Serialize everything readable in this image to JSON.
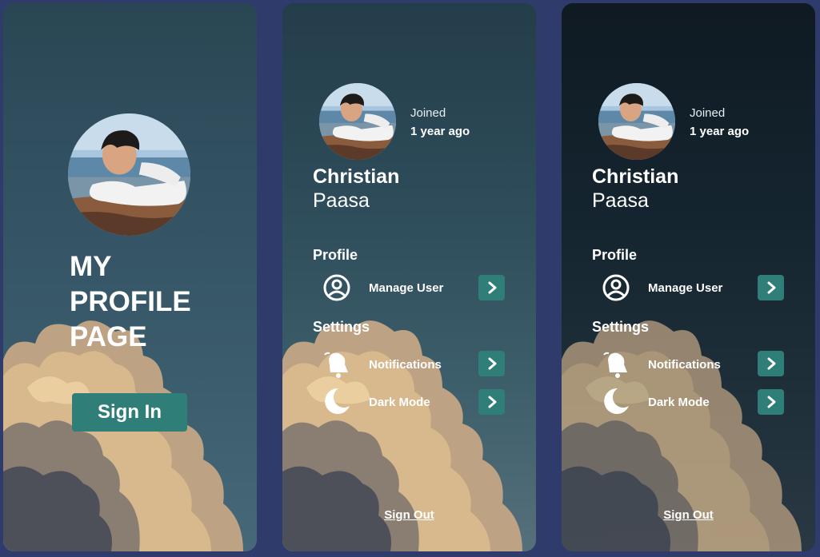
{
  "login": {
    "title_lines": [
      "MY",
      "PROFILE",
      "PAGE"
    ],
    "signin_label": "Sign In"
  },
  "profile_light": {
    "joined_label": "Joined",
    "joined_value": "1 year ago",
    "first_name": "Christian",
    "last_name": "Paasa",
    "profile_section": "Profile",
    "manage_user": "Manage User",
    "settings_section": "Settings",
    "notifications": "Notifications",
    "dark_mode": "Dark Mode",
    "signout": "Sign Out"
  },
  "profile_dark": {
    "joined_label": "Joined",
    "joined_value": "1 year ago",
    "first_name": "Christian",
    "last_name": "Paasa",
    "profile_section": "Profile",
    "manage_user": "Manage User",
    "settings_section": "Settings",
    "notifications": "Notifications",
    "dark_mode": "Dark Mode",
    "signout": "Sign Out"
  },
  "colors": {
    "page_background": "#2e3b6b",
    "accent": "#2f7f78",
    "text": "#ffffff"
  },
  "icons": [
    "user-circle-icon",
    "bell-icon",
    "moon-icon",
    "chevron-right-icon"
  ]
}
